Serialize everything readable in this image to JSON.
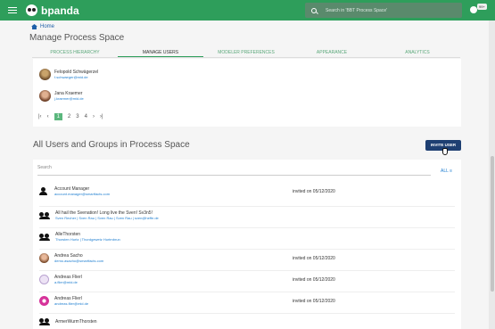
{
  "header": {
    "brand": "bpanda",
    "search_placeholder": "Search in 'BBT Process Space'",
    "notification_badge": "99+"
  },
  "breadcrumb": {
    "home": "Home"
  },
  "page": {
    "title": "Manage Process Space"
  },
  "tabs": [
    {
      "label": "PROCESS HIERARCHY",
      "active": false
    },
    {
      "label": "MANAGE USERS",
      "active": true
    },
    {
      "label": "MODELER PREFERENCES",
      "active": false
    },
    {
      "label": "APPEARANCE",
      "active": false
    },
    {
      "label": "ANALYTICS",
      "active": false
    }
  ],
  "top_list": [
    {
      "name": "Felopold Schwägerzel",
      "email": "f.schwaeger@mid.de"
    },
    {
      "name": "Jana Kraemer",
      "email": "j.kraemer@mid.de"
    }
  ],
  "pagination": {
    "pages": [
      "1",
      "2",
      "3",
      "4"
    ],
    "current": "1"
  },
  "section": {
    "title": "All Users and Groups in Process Space",
    "invite_label": "INVITE USER"
  },
  "filter": {
    "search_placeholder": "Search",
    "all_label": "ALL"
  },
  "users": [
    {
      "name": "Account Manager",
      "sub": "account.manager@smartfacts.com",
      "status": "invited on 05/12/2020",
      "icon": "person-icon"
    },
    {
      "name": "All hail the Svenation! Long live the Sven! Sv3n5!",
      "sub": "Sven Recher | Sven Rau | Sven Rau | Sven Rau | sven@heffe.de",
      "status": "",
      "icon": "group-icon"
    },
    {
      "name": "AlleThorsten",
      "sub": "Thorsten Hurtz | Thordgewetz Hurtmbrun",
      "status": "",
      "icon": "group-icon"
    },
    {
      "name": "Andrea Sacho",
      "sub": "demo.asacho@smartfacts.com",
      "status": "invited on 05/12/2020",
      "icon": "avatar"
    },
    {
      "name": "Andreas Flierl",
      "sub": "a.flier@mid.de",
      "status": "invited on 05/12/2020",
      "icon": "avatar"
    },
    {
      "name": "Andreas Flierl",
      "sub": "andreas.flier@mid.de",
      "status": "invited on 05/12/2020",
      "icon": "avatar"
    },
    {
      "name": "ArmerWurmThorsten",
      "sub": "",
      "status": "",
      "icon": "group-icon"
    }
  ]
}
